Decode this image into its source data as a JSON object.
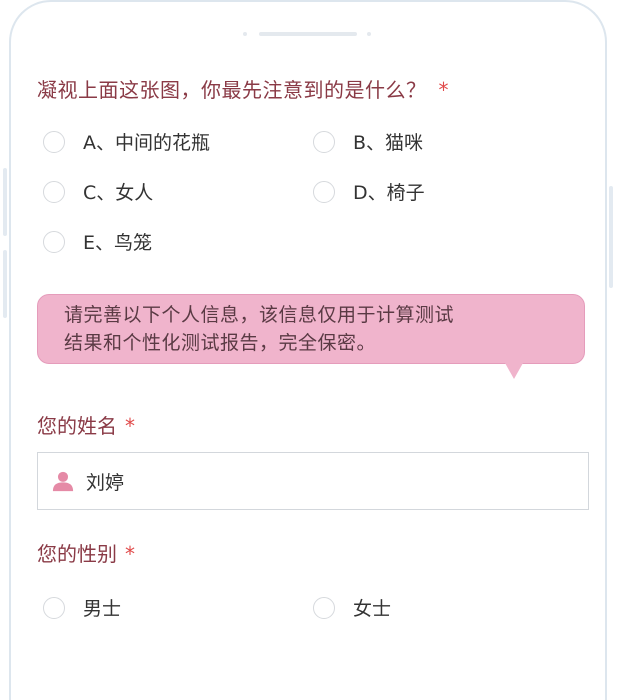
{
  "question": {
    "text": "凝视上面这张图，你最先注意到的是什么？",
    "required_mark": "*",
    "options": [
      {
        "label": "A、中间的花瓶"
      },
      {
        "label": "B、猫咪"
      },
      {
        "label": "C、女人"
      },
      {
        "label": "D、椅子"
      },
      {
        "label": "E、鸟笼"
      }
    ]
  },
  "notice": {
    "line1": "请完善以下个人信息，该信息仅用于计算测试",
    "line2": "结果和个性化测试报告，完全保密。"
  },
  "name_field": {
    "label": "您的姓名",
    "required_mark": "*",
    "value": "刘婷",
    "icon": "user-icon"
  },
  "gender_field": {
    "label": "您的性别",
    "required_mark": "*",
    "options": [
      {
        "label": "男士"
      },
      {
        "label": "女士"
      }
    ]
  },
  "colors": {
    "accent": "#8a3a46",
    "required": "#e04a4a",
    "bubble": "#f0b4cc",
    "icon": "#e58aa6"
  }
}
